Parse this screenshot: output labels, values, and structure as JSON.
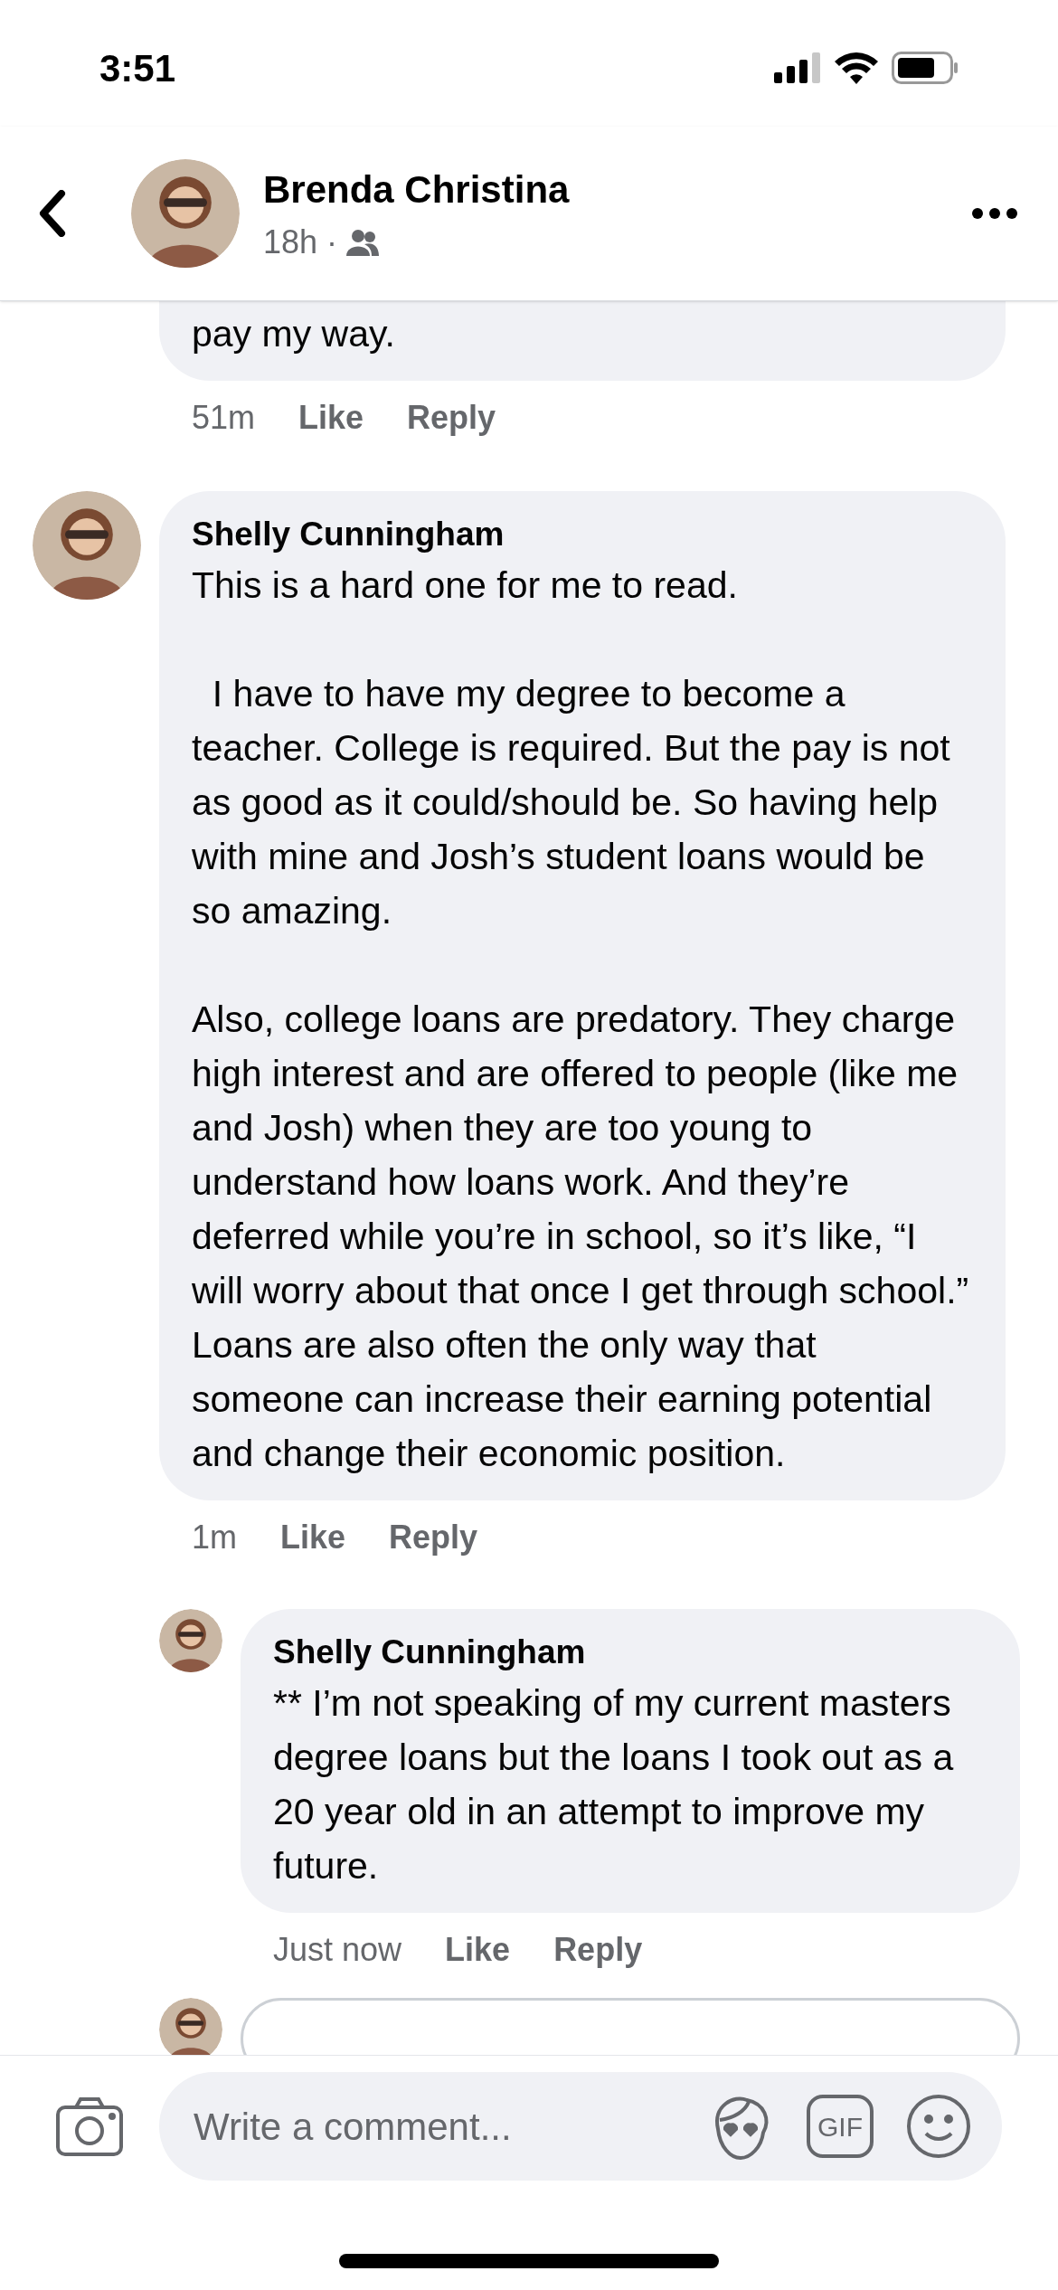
{
  "status_bar": {
    "time": "3:51"
  },
  "header": {
    "title": "Brenda Christina",
    "age": "18h",
    "separator": "·"
  },
  "comments": [
    {
      "paragraphs": [
        "pay my way."
      ],
      "time": "51m",
      "actions": [
        "Like",
        "Reply"
      ]
    },
    {
      "author": "Shelly Cunningham",
      "paragraphs": [
        "This is a hard one for me to read.",
        "  I have to have my degree to become a teacher. College is required. But the pay is not as good as it could/should be. So having help with mine and Josh’s student loans would be so amazing.",
        "Also, college loans are predatory. They charge high interest and are offered to people (like me and Josh) when they are too young to understand how loans work. And they’re deferred while you’re in school, so it’s like, “I will worry about that once I get through school.” Loans are also often the only way that someone can increase their earning potential and change their economic position."
      ],
      "time": "1m",
      "actions": [
        "Like",
        "Reply"
      ],
      "replies": [
        {
          "author": "Shelly Cunningham",
          "paragraphs": [
            "** I’m not speaking of my current masters degree loans but the loans I took out as a 20 year old in an attempt to improve my future."
          ],
          "time": "Just now",
          "actions": [
            "Like",
            "Reply"
          ]
        }
      ]
    }
  ],
  "composer": {
    "placeholder": "Write a comment...",
    "gif_label": "GIF"
  }
}
